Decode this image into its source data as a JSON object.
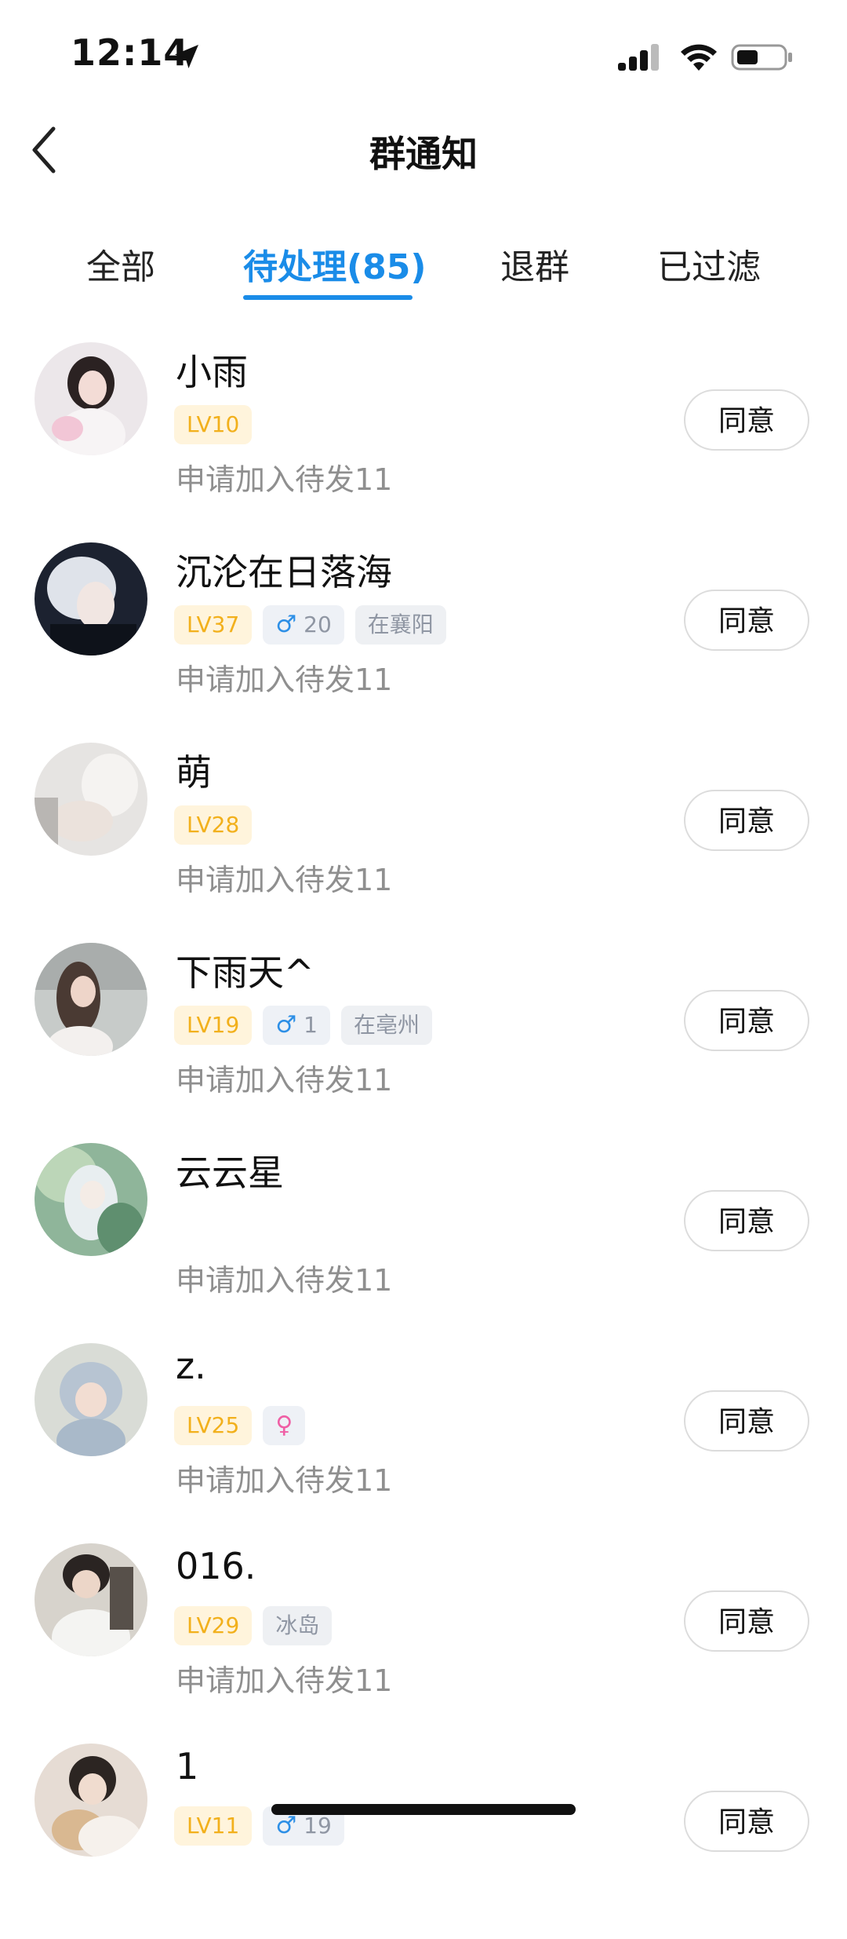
{
  "status_bar": {
    "time": "12:14"
  },
  "nav": {
    "title": "群通知"
  },
  "tabs": [
    {
      "label": "全部",
      "active": false
    },
    {
      "label": "待处理(85)",
      "active": true
    },
    {
      "label": "退群",
      "active": false
    },
    {
      "label": "已过滤",
      "active": false
    }
  ],
  "colors": {
    "accent": "#1a8ce8",
    "level_text": "#f2b01c",
    "male": "#2d8fe6",
    "female": "#ef5fa5"
  },
  "requests": [
    {
      "name": "小雨",
      "level": "LV10",
      "gender": null,
      "age": null,
      "location": null,
      "message": "申请加入待发11",
      "action": "同意"
    },
    {
      "name": "沉沦在日落海",
      "level": "LV37",
      "gender": "♂",
      "age": "20",
      "location": "在襄阳",
      "message": "申请加入待发11",
      "action": "同意"
    },
    {
      "name": "萌",
      "level": "LV28",
      "gender": null,
      "age": null,
      "location": null,
      "message": "申请加入待发11",
      "action": "同意"
    },
    {
      "name": "下雨天^",
      "level": "LV19",
      "gender": "♂",
      "age": "1",
      "location": "在亳州",
      "message": "申请加入待发11",
      "action": "同意"
    },
    {
      "name": "云云星",
      "level": null,
      "gender": null,
      "age": null,
      "location": null,
      "message": "申请加入待发11",
      "action": "同意"
    },
    {
      "name": "z.",
      "level": "LV25",
      "gender": "♀",
      "age": null,
      "location": null,
      "message": "申请加入待发11",
      "action": "同意"
    },
    {
      "name": "016.",
      "level": "LV29",
      "gender": null,
      "age": null,
      "location": "冰岛",
      "message": "申请加入待发11",
      "action": "同意"
    },
    {
      "name": "1",
      "level": "LV11",
      "gender": "♂",
      "age": "19",
      "location": null,
      "message": "",
      "action": "同意"
    }
  ]
}
